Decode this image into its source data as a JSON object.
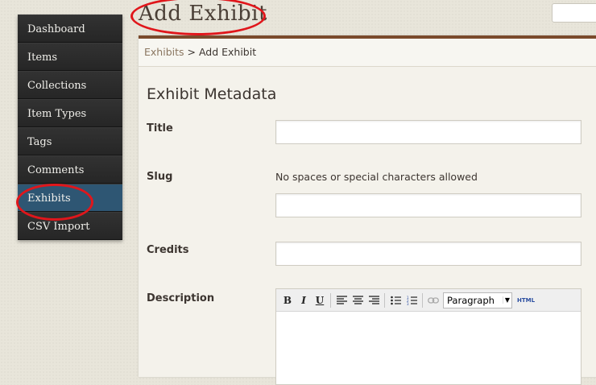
{
  "sidebar": {
    "items": [
      {
        "label": "Dashboard"
      },
      {
        "label": "Items"
      },
      {
        "label": "Collections"
      },
      {
        "label": "Item Types"
      },
      {
        "label": "Tags"
      },
      {
        "label": "Comments"
      },
      {
        "label": "Exhibits",
        "active": true
      },
      {
        "label": "CSV Import"
      }
    ]
  },
  "header": {
    "title": "Add Exhibit"
  },
  "breadcrumb": {
    "parent": "Exhibits",
    "separator": " > ",
    "current": "Add Exhibit"
  },
  "form": {
    "section_title": "Exhibit Metadata",
    "title_label": "Title",
    "slug_label": "Slug",
    "slug_hint": "No spaces or special characters allowed",
    "credits_label": "Credits",
    "description_label": "Description"
  },
  "editor": {
    "bold": "B",
    "italic": "I",
    "underline": "U",
    "format_value": "Paragraph",
    "html_label": "HTML"
  },
  "colors": {
    "accent_bar": "#7a4a2c",
    "active_nav": "#2e5673",
    "annotation_red": "#e0161b"
  }
}
